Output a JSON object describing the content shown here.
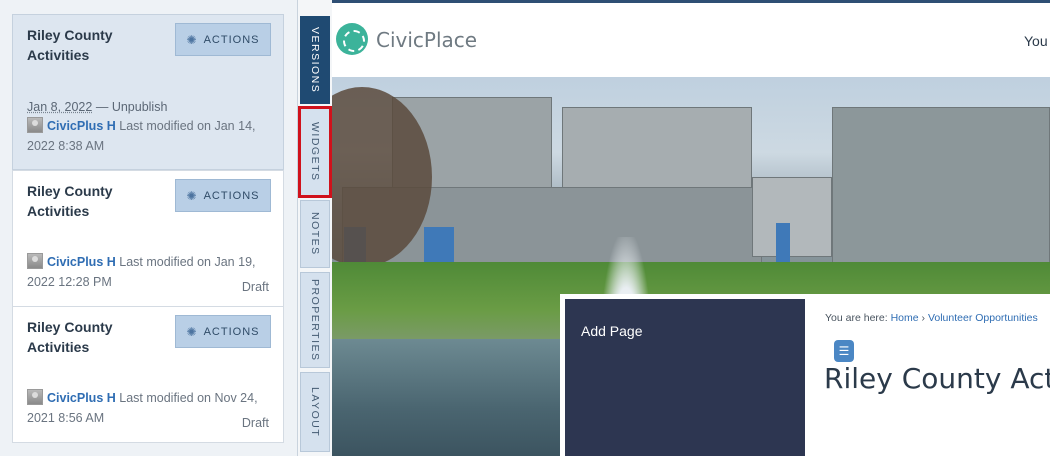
{
  "versions": [
    {
      "title": "Riley County Activities",
      "actions_label": "ACTIONS",
      "date": "Jan 8, 2022",
      "separator": "—",
      "date_action": "Unpublish",
      "author": "CivicPlus H",
      "modified_label": "Last modified on",
      "modified_date": "Jan 14, 2022 8:38 AM",
      "status": ""
    },
    {
      "title": "Riley County Activities",
      "actions_label": "ACTIONS",
      "author": "CivicPlus H",
      "modified_label": "Last modified on",
      "modified_date": "Jan 19, 2022 12:28 PM",
      "status": "Draft"
    },
    {
      "title": "Riley County Activities",
      "actions_label": "ACTIONS",
      "author": "CivicPlus H",
      "modified_label": "Last modified on",
      "modified_date": "Nov 24, 2021 8:56 AM",
      "status": "Draft"
    }
  ],
  "tabs": [
    {
      "label": "VERSIONS",
      "active": true
    },
    {
      "label": "WIDGETS",
      "active": false,
      "highlighted": true
    },
    {
      "label": "NOTES",
      "active": false
    },
    {
      "label": "PROPERTIES",
      "active": false
    },
    {
      "label": "LAYOUT",
      "active": false
    }
  ],
  "site": {
    "logo_text": "CivicPlace",
    "header_right": "You",
    "add_page_label": "Add Page",
    "breadcrumb_prefix": "You are here:",
    "breadcrumb": [
      "Home",
      "Volunteer Opportunities"
    ],
    "breadcrumb_separator": "›",
    "page_heading": "Riley County Act"
  },
  "colors": {
    "active_tab": "#1f4a72",
    "highlight_outline": "#d0111b",
    "author_link": "#2f6db3",
    "actions_button": "#b9cfe6"
  },
  "icons": [
    "gear-icon",
    "avatar-icon",
    "logo-icon",
    "list-icon"
  ]
}
